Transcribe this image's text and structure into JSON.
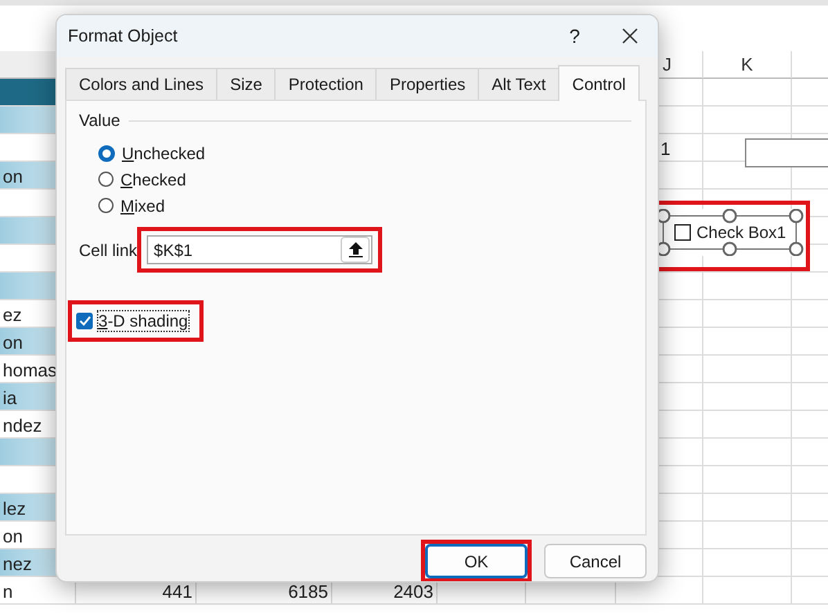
{
  "sheet": {
    "column_headers": [
      {
        "label": "J"
      },
      {
        "label": "K"
      }
    ],
    "rows": [
      {},
      {},
      {
        "j_cell": "1"
      },
      {
        "name": "on"
      },
      {},
      {},
      {},
      {},
      {
        "name": "ez"
      },
      {
        "name": "on"
      },
      {
        "name": "homas"
      },
      {
        "name": "ia"
      },
      {
        "name": "ndez"
      },
      {},
      {},
      {
        "name": "lez"
      },
      {
        "name": "on"
      },
      {
        "name": "nez"
      },
      {
        "name": "n",
        "values": [
          "441",
          "6185",
          "2403"
        ]
      }
    ]
  },
  "check_box": {
    "label": "Check Box1",
    "checked": false,
    "selected": true,
    "highlighted": true
  },
  "dialog": {
    "title": "Format Object",
    "help": "?",
    "tabs": [
      {
        "label": "Colors and Lines",
        "selected": false
      },
      {
        "label": "Size",
        "selected": false
      },
      {
        "label": "Protection",
        "selected": false
      },
      {
        "label": "Properties",
        "selected": false
      },
      {
        "label": "Alt Text",
        "selected": false
      },
      {
        "label": "Control",
        "selected": true
      }
    ],
    "value_group": {
      "label": "Value",
      "options": [
        {
          "label": "Unchecked",
          "selected": true
        },
        {
          "label": "Checked",
          "selected": false
        },
        {
          "label": "Mixed",
          "selected": false
        }
      ]
    },
    "cell_link": {
      "label": "Cell link",
      "value": "$K$1",
      "highlighted": true
    },
    "shading": {
      "label": "3-D shading",
      "checked": true,
      "highlighted": true
    },
    "buttons": [
      {
        "label": "OK",
        "default": true,
        "highlighted": true
      },
      {
        "label": "Cancel",
        "default": false,
        "highlighted": false
      }
    ]
  }
}
